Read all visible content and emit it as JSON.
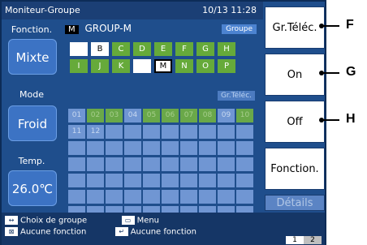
{
  "title": "Moniteur-Groupe",
  "datetime": "10/13 11:28",
  "left": {
    "fonction_label": "Fonction.",
    "fonction_value": "Mixte",
    "mode_label": "Mode",
    "mode_value": "Froid",
    "temp_label": "Temp.",
    "temp_value": "26.0℃"
  },
  "group": {
    "badge": "M",
    "name": "GROUP-M",
    "groupe_btn": "Groupe",
    "letters_row1": [
      "",
      "B",
      "C",
      "D",
      "E",
      "F",
      "G",
      "H"
    ],
    "letters_row2": [
      "I",
      "J",
      "K",
      "",
      "M",
      "N",
      "O",
      "P"
    ],
    "rc_label": "Gr.Téléc."
  },
  "units_row1": [
    "01",
    "02",
    "03",
    "04",
    "05",
    "06",
    "07",
    "08",
    "09",
    "10"
  ],
  "units_row2": [
    "11",
    "12"
  ],
  "bottom": {
    "line1_icon": "↔",
    "line1_text": "Choix de groupe",
    "line1b_icon": "▭",
    "line1b_text": "Menu",
    "line2_icon": "⊠",
    "line2_text": "Aucune fonction",
    "line2b_icon": "↵",
    "line2b_text": "Aucune fonction",
    "page1": "1",
    "page2": "2"
  },
  "side_buttons": {
    "gr_telec": "Gr.Téléc.",
    "on": "On",
    "off": "Off",
    "fonction": "Fonction.",
    "details": "Détails"
  },
  "callouts": [
    "F",
    "G",
    "H"
  ]
}
